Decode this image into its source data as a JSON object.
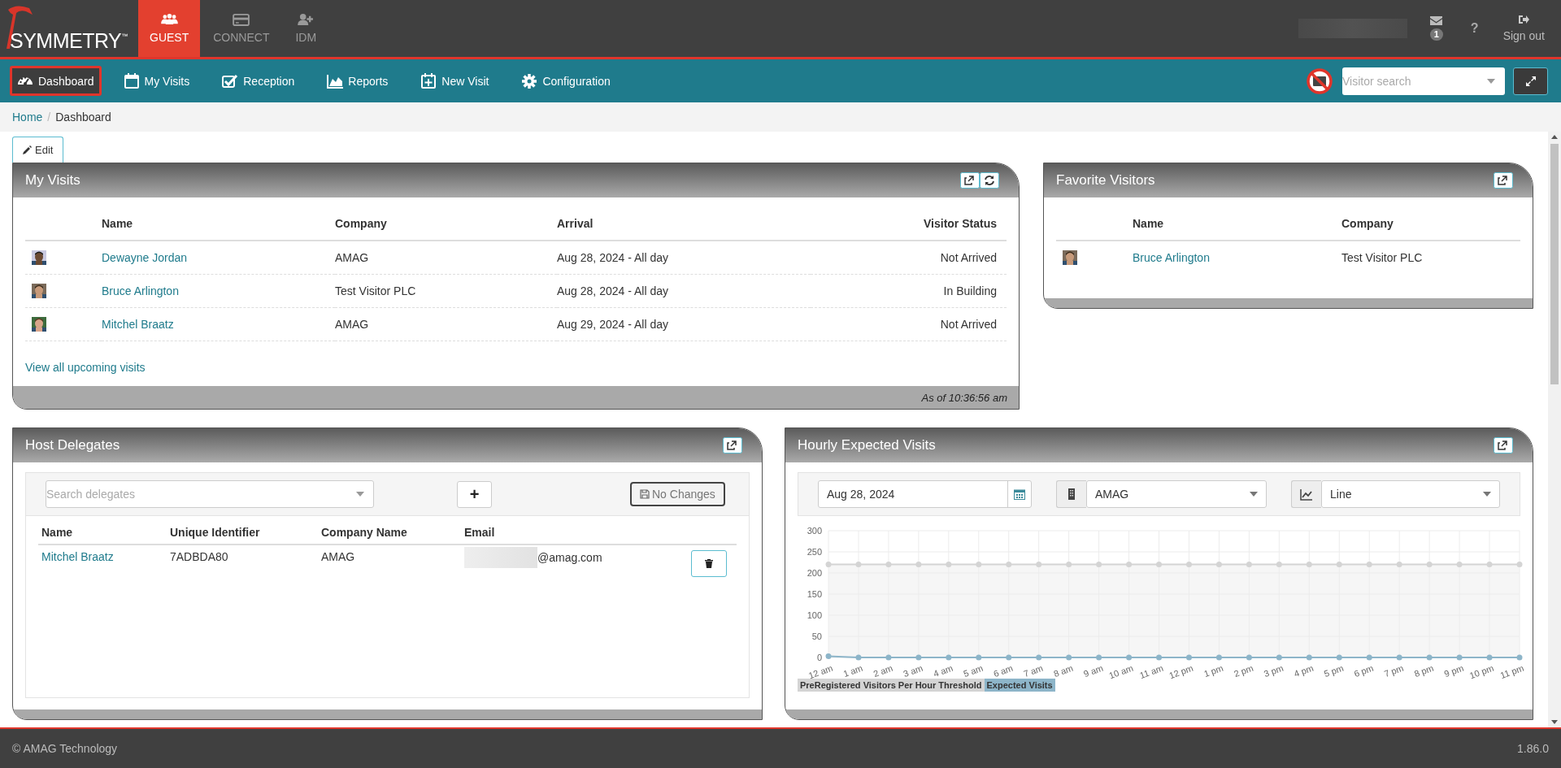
{
  "app": {
    "logo": "SYMMETRY",
    "logo_mark": "™"
  },
  "modules": [
    {
      "label": "GUEST",
      "selected": true
    },
    {
      "label": "CONNECT",
      "selected": false
    },
    {
      "label": "IDM",
      "selected": false
    }
  ],
  "user_menu": {
    "message_count": "1",
    "help": "?",
    "sign_out": "Sign out"
  },
  "nav": {
    "items": [
      {
        "label": "Dashboard",
        "selected": true
      },
      {
        "label": "My Visits",
        "selected": false
      },
      {
        "label": "Reception",
        "selected": false
      },
      {
        "label": "Reports",
        "selected": false
      },
      {
        "label": "New Visit",
        "selected": false
      },
      {
        "label": "Configuration",
        "selected": false
      }
    ],
    "visitor_search": {
      "placeholder": "Visitor search"
    }
  },
  "breadcrumb": {
    "items": [
      "Home",
      "Dashboard"
    ],
    "separator": "/"
  },
  "edit_button": "Edit",
  "my_visits": {
    "title": "My Visits",
    "columns": [
      "Name",
      "Company",
      "Arrival",
      "Visitor Status"
    ],
    "rows": [
      {
        "name": "Dewayne Jordan",
        "company": "AMAG",
        "arrival": "Aug 28, 2024 - All day",
        "status": "Not Arrived"
      },
      {
        "name": "Bruce Arlington",
        "company": "Test Visitor PLC",
        "arrival": "Aug 28, 2024 - All day",
        "status": "In Building"
      },
      {
        "name": "Mitchel Braatz",
        "company": "AMAG",
        "arrival": "Aug 29, 2024 - All day",
        "status": "Not Arrived"
      }
    ],
    "link": "View all upcoming visits",
    "footer": "As of 10:36:56 am"
  },
  "favorite_visitors": {
    "title": "Favorite Visitors",
    "columns": [
      "Name",
      "Company"
    ],
    "rows": [
      {
        "name": "Bruce Arlington",
        "company": "Test Visitor PLC"
      }
    ]
  },
  "host_delegates": {
    "title": "Host Delegates",
    "search": {
      "placeholder": "Search delegates"
    },
    "add_button": "+",
    "save_button": "No Changes",
    "columns": [
      "Name",
      "Unique Identifier",
      "Company Name",
      "Email"
    ],
    "rows": [
      {
        "name": "Mitchel Braatz",
        "identifier": "7ADBDA80",
        "company": "AMAG",
        "email": "@amag.com"
      }
    ]
  },
  "hourly_expected_visits": {
    "title": "Hourly Expected Visits",
    "date": "Aug 28, 2024",
    "company": "AMAG",
    "chart_type": "Line",
    "chart_data": {
      "type": "area",
      "categories": [
        "12 am",
        "1 am",
        "2 am",
        "3 am",
        "4 am",
        "5 am",
        "6 am",
        "7 am",
        "8 am",
        "9 am",
        "10 am",
        "11 am",
        "12 pm",
        "1 pm",
        "2 pm",
        "3 pm",
        "4 pm",
        "5 pm",
        "6 pm",
        "7 pm",
        "8 pm",
        "9 pm",
        "10 pm",
        "11 pm"
      ],
      "ylim": [
        0,
        300
      ],
      "yticks": [
        0,
        50,
        100,
        150,
        200,
        250,
        300
      ],
      "grid": true,
      "series": [
        {
          "name": "PreRegistered Visitors Per Hour Threshold",
          "color": "#d4d4d4",
          "marker": true,
          "values": [
            220,
            220,
            220,
            220,
            220,
            220,
            220,
            220,
            220,
            220,
            220,
            220,
            220,
            220,
            220,
            220,
            220,
            220,
            220,
            220,
            220,
            220,
            220,
            220
          ]
        },
        {
          "name": "Expected Visits",
          "color": "#8db5c9",
          "marker": true,
          "values": [
            3,
            0,
            0,
            0,
            0,
            0,
            0,
            0,
            0,
            0,
            0,
            0,
            0,
            0,
            0,
            0,
            0,
            0,
            0,
            0,
            0,
            0,
            0,
            0
          ]
        }
      ]
    }
  },
  "footer": {
    "copyright": "© AMAG Technology",
    "version": "1.86.0"
  }
}
